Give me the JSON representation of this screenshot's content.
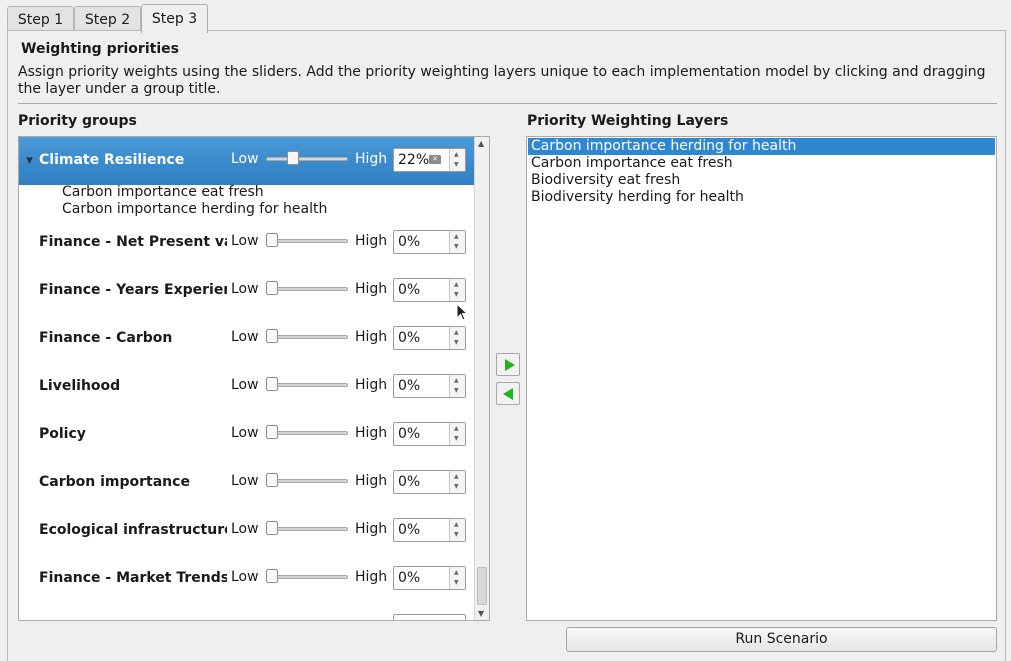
{
  "tabs": [
    {
      "label": "Step 1",
      "active": false
    },
    {
      "label": "Step 2",
      "active": false
    },
    {
      "label": "Step 3",
      "active": true
    }
  ],
  "section": {
    "title": "Weighting priorities",
    "description": "Assign priority weights using the sliders. Add the priority weighting layers unique to each implementation model by clicking and dragging the layer under a group title."
  },
  "priority_groups": {
    "label": "Priority groups",
    "low_label": "Low",
    "high_label": "High",
    "groups": [
      {
        "name": "Climate Resilience",
        "value": "22%",
        "level": 0.22,
        "selected": true,
        "expanded": true,
        "children": [
          "Carbon importance eat fresh",
          "Carbon importance herding for health"
        ]
      },
      {
        "name": "Finance - Net Present value",
        "value": "0%",
        "level": 0
      },
      {
        "name": "Finance - Years Experience",
        "value": "0%",
        "level": 0
      },
      {
        "name": "Finance - Carbon",
        "value": "0%",
        "level": 0
      },
      {
        "name": "Livelihood",
        "value": "0%",
        "level": 0
      },
      {
        "name": "Policy",
        "value": "0%",
        "level": 0
      },
      {
        "name": "Carbon importance",
        "value": "0%",
        "level": 0
      },
      {
        "name": "Ecological infrastructure",
        "value": "0%",
        "level": 0
      },
      {
        "name": "Finance - Market Trends",
        "value": "0%",
        "level": 0
      }
    ]
  },
  "priority_layers": {
    "label": "Priority Weighting Layers",
    "items": [
      {
        "label": "Carbon importance herding for health",
        "selected": true
      },
      {
        "label": "Carbon importance eat fresh",
        "selected": false
      },
      {
        "label": "Biodiversity eat fresh",
        "selected": false
      },
      {
        "label": "Biodiversity herding for health",
        "selected": false
      }
    ]
  },
  "buttons": {
    "add_icon": "arrow-right-icon",
    "remove_icon": "arrow-left-icon",
    "run_label": "Run Scenario"
  },
  "colors": {
    "selection": "#2f87d0",
    "arrow": "#22b322"
  }
}
